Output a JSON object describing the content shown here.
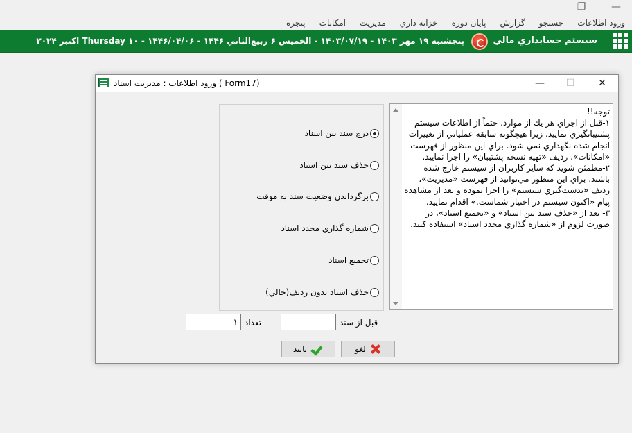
{
  "window_controls": {
    "restore": "❐",
    "minimize": "—"
  },
  "menu": {
    "items": [
      "ورود اطلاعات",
      "جستجو",
      "گزارش",
      "پايان دوره",
      "خزانه داري",
      "مديريت",
      "امکانات",
      "پنجره"
    ]
  },
  "header": {
    "app_title": "سيستم حسابداري مالي",
    "date_line": "پنجشنبه ۱۹ مهر ۱۴۰۳ - ۱۴۰۳/۰۷/۱۹ - الخميس ۶ ربيع‌الثاني ۱۴۴۶ - ۱۴۴۶/۰۴/۰۶ - ۱۰ Thursday اکتبر ۲۰۲۴"
  },
  "dialog": {
    "title": "ورود اطلاعات : مديريت اسناد ( Form17)",
    "close_glyph": "✕",
    "maximize_glyph": "☐",
    "minimize_glyph": "—",
    "options": [
      {
        "label": "درج سند بين اسناد",
        "checked": true
      },
      {
        "label": "حذف سند بين اسناد",
        "checked": false
      },
      {
        "label": "برگرداندن وضعيت سند به موقت",
        "checked": false
      },
      {
        "label": "شماره گذاري مجدد اسناد",
        "checked": false
      },
      {
        "label": "تجميع اسناد",
        "checked": false
      },
      {
        "label": "حذف اسناد بدون رديف(خالي)",
        "checked": false
      }
    ],
    "notes": "توجه!!\n۱-قبل از اجراي هر يك از موارد، حتماً از اطلاعات سيستم پشتيبانگيري نماييد. زيرا هيچگونه سابقه عملياتي از تغييرات انجام شده نگهداري نمي شود. براي اين منظور از فهرست «امكانات»، رديف «تهيه نسخه پشتيبان» را اجرا نماييد.\n۲-مطمئن شويد كه ساير كاربران از سيستم خارج شده باشند. براي اين منظور مي‌توانيد از فهرست «مديريت»، رديف «بدست‌گيري سيستم» را اجرا نموده و بعد از مشاهده پيام «اكنون سيستم در اختيار شماست.» اقدام نماييد.\n۳- بعد از «حذف سند بين اسناد» و «تجميع اسناد»، در صورت لزوم از «شماره گذاري مجدد اسناد» استفاده كنيد.",
    "before_doc_label": "قبل از سند",
    "before_doc_value": "",
    "count_label": "تعداد",
    "count_value": "۱",
    "confirm_label": "تاييد",
    "cancel_label": "لغو"
  }
}
